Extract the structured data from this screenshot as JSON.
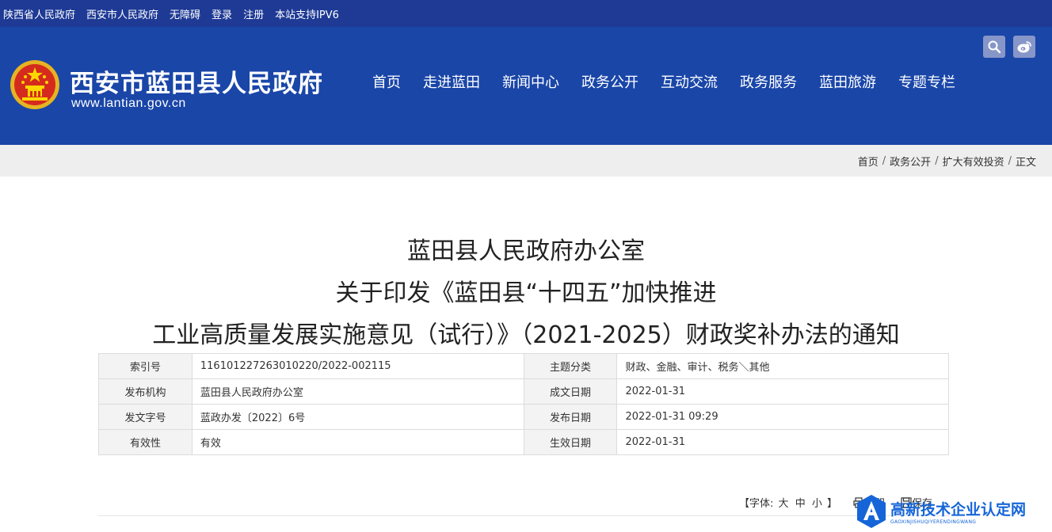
{
  "topbar": {
    "links": [
      "陕西省人民政府",
      "西安市人民政府",
      "无障碍",
      "登录",
      "注册",
      "本站支持IPV6"
    ]
  },
  "header": {
    "site_name": "西安市蓝田县人民政府",
    "site_url": "www.lantian.gov.cn",
    "nav": [
      "首页",
      "走进蓝田",
      "新闻中心",
      "政务公开",
      "互动交流",
      "政务服务",
      "蓝田旅游",
      "专题专栏"
    ],
    "icons": [
      "search-icon",
      "weibo-icon"
    ]
  },
  "breadcrumb": [
    "首页",
    "政务公开",
    "扩大有效投资",
    "正文"
  ],
  "document": {
    "title_lines": [
      "蓝田县人民政府办公室",
      "关于印发《蓝田县“十四五”加快推进",
      "工业高质量发展实施意见（试行）》（2021-2025）财政奖补办法的通知"
    ],
    "meta": [
      [
        "索引号",
        "116101227263010220/2022-002115",
        "主题分类",
        "财政、金融、审计、税务＼其他"
      ],
      [
        "发布机构",
        "蓝田县人民政府办公室",
        "成文日期",
        "2022-01-31"
      ],
      [
        "发文字号",
        "蓝政办发〔2022〕6号",
        "发布日期",
        "2022-01-31 09:29"
      ],
      [
        "有效性",
        "有效",
        "生效日期",
        "2022-01-31"
      ]
    ]
  },
  "tools": {
    "font_label": "【字体:",
    "font_big": "大",
    "font_mid": "中",
    "font_small": "小",
    "font_close": "】",
    "print_label": "打印",
    "save_label": "保存"
  },
  "watermark": {
    "cn": "高新技术企业认定网",
    "en": "GAOXINJISHUQIYERENDINGWANG"
  },
  "colors": {
    "topbar": "#1e3a95",
    "header": "#1a46a8",
    "crumbbar": "#eeeeee",
    "watermark": "#1565d8"
  }
}
